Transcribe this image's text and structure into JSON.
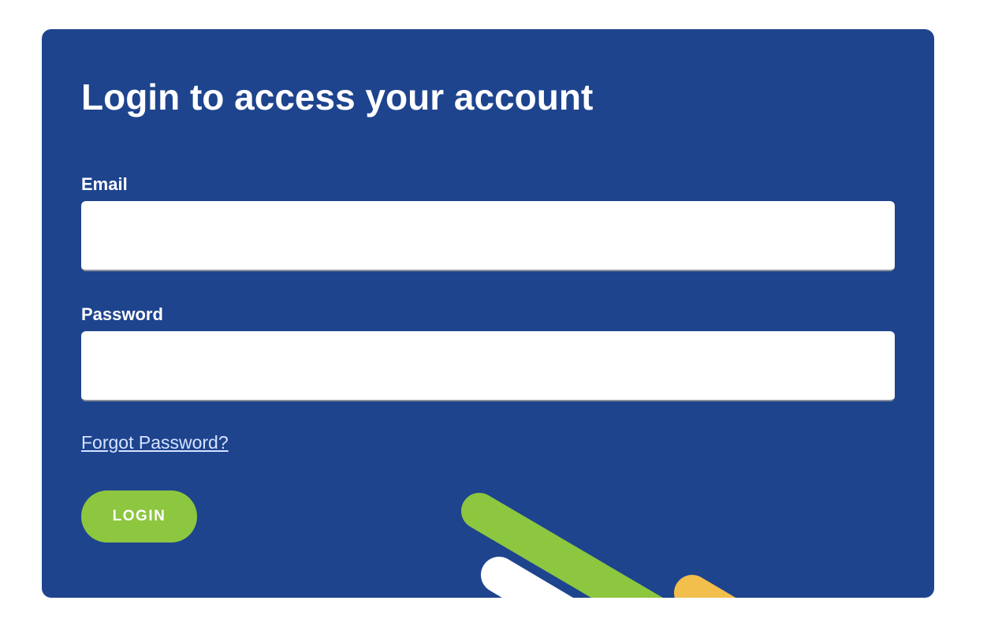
{
  "login_form": {
    "title": "Login to access your account",
    "email_label": "Email",
    "email_value": "",
    "password_label": "Password",
    "password_value": "",
    "forgot_link": "Forgot Password?",
    "login_button": "LOGIN"
  },
  "colors": {
    "card_background": "#1e448e",
    "button_green": "#8dc63f",
    "stripe_green": "#8dc63f",
    "stripe_white": "#ffffff",
    "stripe_yellow": "#f2be4c"
  }
}
